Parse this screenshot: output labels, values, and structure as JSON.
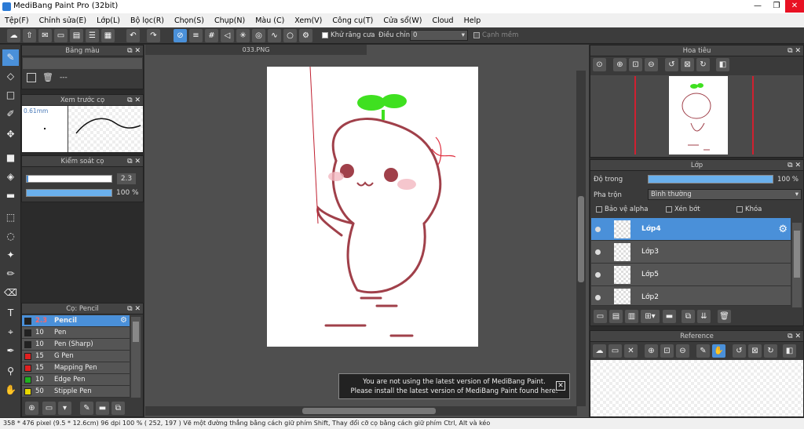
{
  "window": {
    "title": "MediBang Paint Pro (32bit)",
    "min": "—",
    "max": "❐",
    "close": "✕"
  },
  "menu": [
    "Tệp(F)",
    "Chỉnh sửa(E)",
    "Lớp(L)",
    "Bộ lọc(R)",
    "Chọn(S)",
    "Chụp(N)",
    "Màu (C)",
    "Xem(V)",
    "Công cụ(T)",
    "Cửa sổ(W)",
    "Cloud",
    "Help"
  ],
  "toolbar": {
    "antialias_label": "Khử răng cưa",
    "correction_label": "Điều chỉnh",
    "correction_value": "0",
    "smooth_label": "Cạnh mềm"
  },
  "palette_panel": {
    "title": "Bảng màu",
    "value": "---"
  },
  "preview_panel": {
    "title": "Xem trước cọ",
    "size": "0.61mm"
  },
  "brush_control": {
    "title": "Kiểm soát cọ",
    "size": "2.3",
    "opacity": "100 %"
  },
  "brush_list": {
    "title": "Cọ: Pencil",
    "items": [
      {
        "size": "2.3",
        "name": "Pencil",
        "color": "#222222"
      },
      {
        "size": "10",
        "name": "Pen",
        "color": "#222222"
      },
      {
        "size": "10",
        "name": "Pen (Sharp)",
        "color": "#222222"
      },
      {
        "size": "15",
        "name": "G Pen",
        "color": "#e02020"
      },
      {
        "size": "15",
        "name": "Mapping Pen",
        "color": "#e02020"
      },
      {
        "size": "10",
        "name": "Edge Pen",
        "color": "#20b020"
      },
      {
        "size": "50",
        "name": "Stipple Pen",
        "color": "#e8d800"
      }
    ]
  },
  "canvas": {
    "tab": "033.PNG"
  },
  "navigator": {
    "title": "Hoa tiêu"
  },
  "layers": {
    "title": "Lớp",
    "opacity_label": "Độ trong",
    "opacity_value": "100 %",
    "blend_label": "Pha trộn",
    "blend_value": "Bình thường",
    "protect_alpha": "Bảo vệ alpha",
    "clipping": "Xén bớt",
    "lock": "Khóa",
    "items": [
      "Lớp4",
      "Lớp3",
      "Lớp5",
      "Lớp2"
    ]
  },
  "reference": {
    "title": "Reference"
  },
  "notification": {
    "line1": "You are not using the latest version of MediBang Paint.",
    "line2": "Please install the latest version of MediBang Paint found here.",
    "close": "✕"
  },
  "status": {
    "text": "358 * 476 pixel  (9.5 * 12.6cm)  96 dpi  100 %  ( 252, 197 )  Vẽ một đường thẳng bằng cách giữ phím Shift, Thay đổi cỡ cọ bằng cách giữ phím Ctrl, Alt và kéo"
  },
  "colors": {
    "accent": "#4a90d9",
    "stroke": "#a0404a",
    "sprout": "#3fe020"
  }
}
